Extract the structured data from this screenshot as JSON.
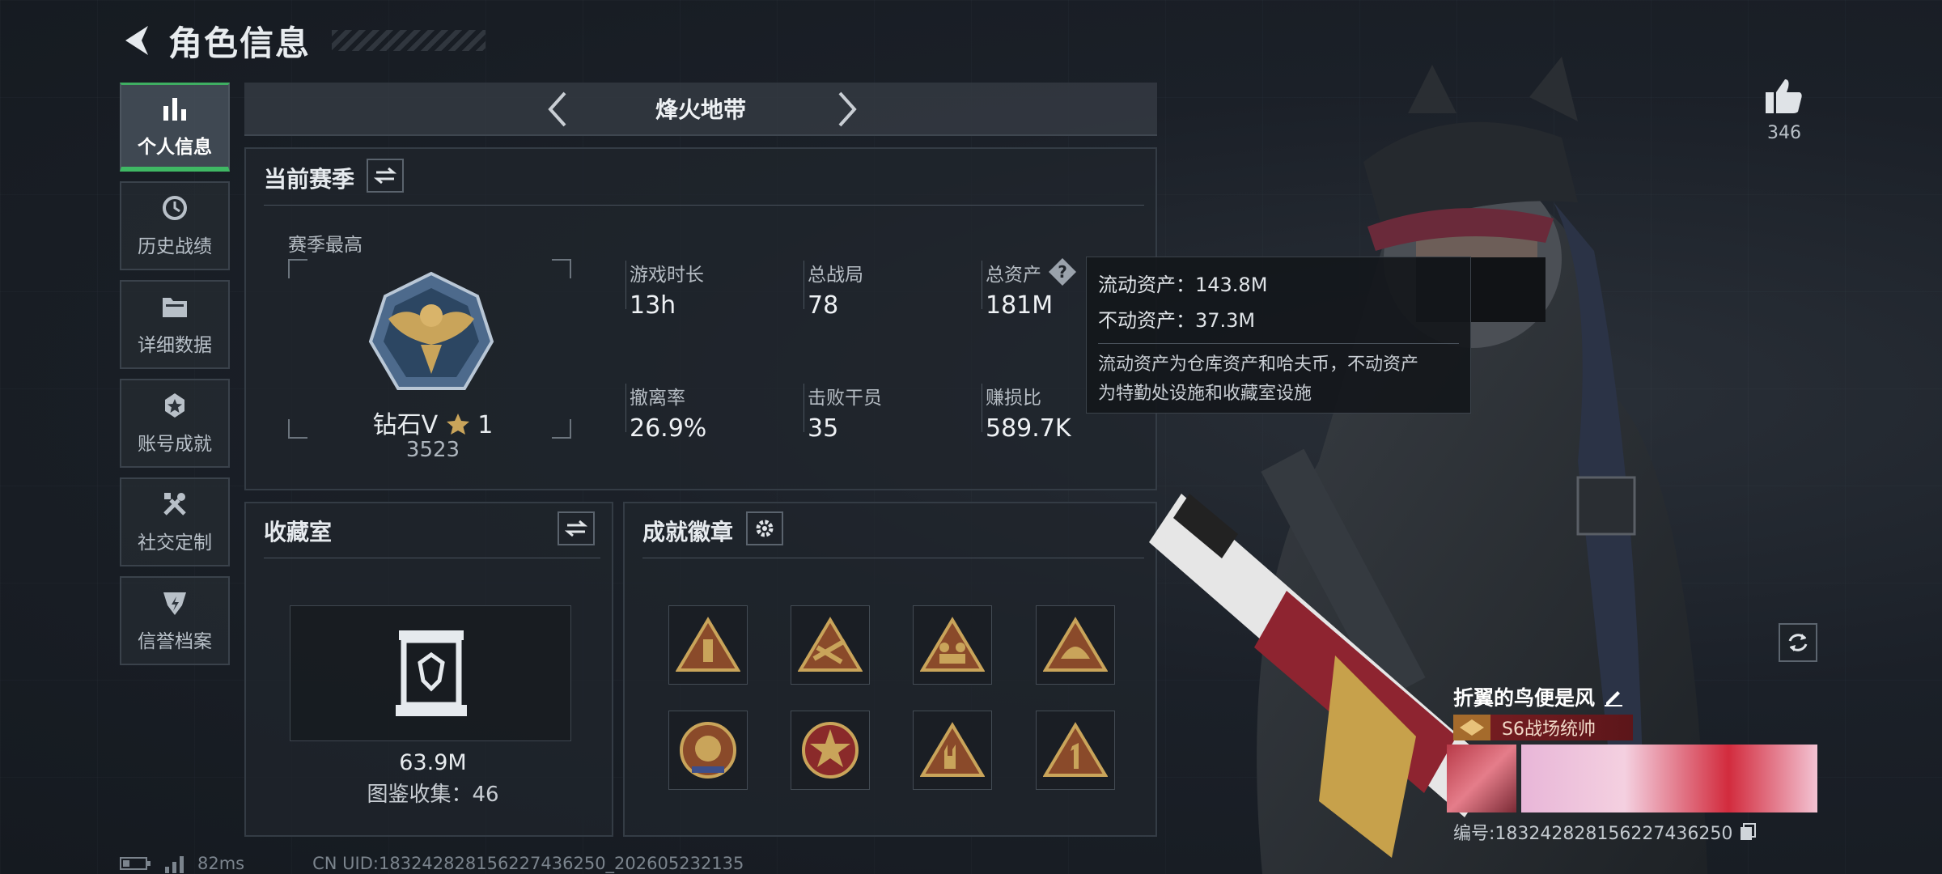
{
  "header": {
    "title": "角色信息"
  },
  "nav": {
    "items": [
      {
        "label": "个人信息",
        "icon": "bar-chart-icon",
        "active": true
      },
      {
        "label": "历史战绩",
        "icon": "history-clock-icon",
        "active": false
      },
      {
        "label": "详细数据",
        "icon": "folder-icon",
        "active": false
      },
      {
        "label": "账号成就",
        "icon": "achievement-star-icon",
        "active": false
      },
      {
        "label": "社交定制",
        "icon": "tools-icon",
        "active": false
      },
      {
        "label": "信誉档案",
        "icon": "reputation-shield-icon",
        "active": false
      }
    ]
  },
  "mode": {
    "title": "烽火地带"
  },
  "season": {
    "title": "当前赛季",
    "sub_title": "赛季最高",
    "rank_name": "钻石V",
    "rank_stars": "1",
    "rank_score": "3523",
    "stats": [
      {
        "label": "游戏时长",
        "value": "13h"
      },
      {
        "label": "总战局",
        "value": "78"
      },
      {
        "label": "总资产",
        "value": "181M"
      },
      {
        "label": "撤离率",
        "value": "26.9%"
      },
      {
        "label": "击败干员",
        "value": "35"
      },
      {
        "label": "赚损比",
        "value": "589.7K"
      }
    ]
  },
  "tooltip": {
    "liquid": "流动资产：143.8M",
    "fixed": "不动资产：37.3M",
    "desc_line1": "流动资产为仓库资产和哈夫币，不动资产",
    "desc_line2": "为特勤处设施和收藏室设施"
  },
  "showcase": {
    "title": "收藏室",
    "value": "63.9M",
    "collection": "图鉴收集：46"
  },
  "achievements": {
    "title": "成就徽章",
    "badges": [
      "bullet-triangle-badge-icon",
      "weapons-triangle-badge-icon",
      "squad-triangle-badge-icon",
      "helmet-triangle-badge-icon",
      "tiger-round-badge-icon",
      "star-round-badge-icon",
      "rock-hand-triangle-badge-icon",
      "number-one-triangle-badge-icon"
    ]
  },
  "profile": {
    "likes": "346",
    "player_name": "折翼的鸟便是风",
    "player_title": "S6战场统帅",
    "player_id": "编号:183242828156227436250"
  },
  "footer": {
    "ping": "82ms",
    "uid": "CN UID:183242828156227436250_202605232135"
  },
  "colors": {
    "accent_green": "#3fb864",
    "title_tag_red": "#7a1e22",
    "gold": "#c9a45a"
  }
}
